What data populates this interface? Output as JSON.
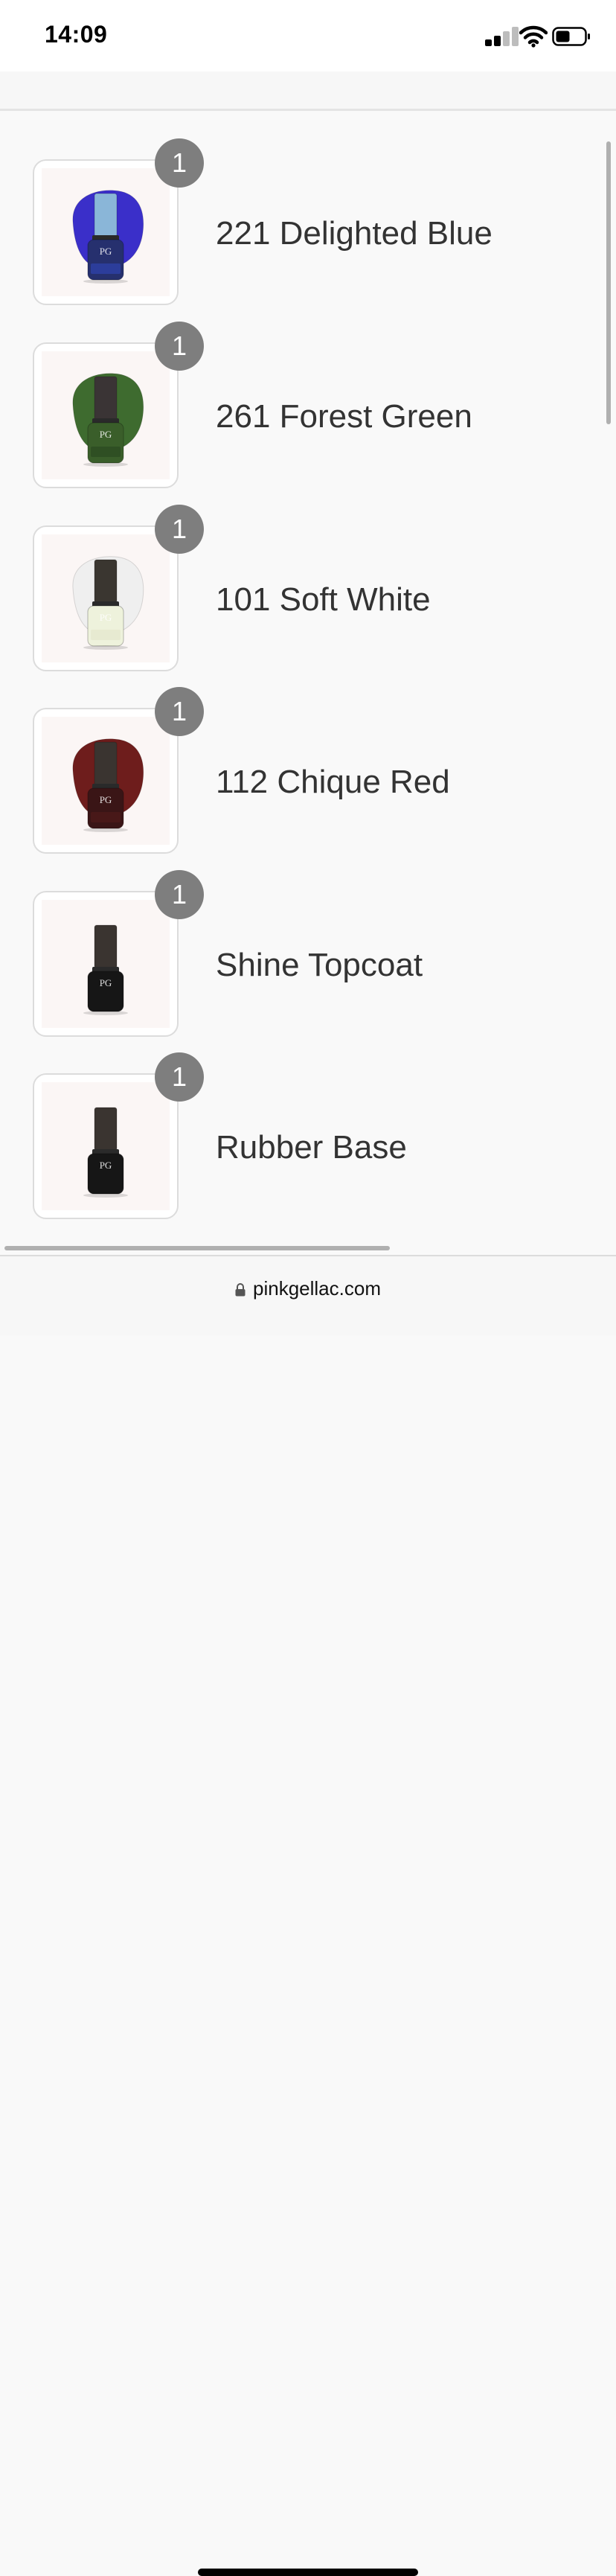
{
  "status_bar": {
    "time": "14:09"
  },
  "cart": {
    "items": [
      {
        "name": "221 Delighted Blue",
        "quantity": "1",
        "swatch": "#3a2fc9",
        "bottle": "#26306e",
        "cap": "#8ab6d8",
        "label": "#2d3fa0",
        "image": "delighted-blue-polish-image"
      },
      {
        "name": "261 Forest Green",
        "quantity": "1",
        "swatch": "#3e6b2f",
        "bottle": "#3a5e2a",
        "cap": "#3a3435",
        "label": "#2f4e22",
        "image": "forest-green-polish-image"
      },
      {
        "name": "101 Soft White",
        "quantity": "1",
        "swatch": "#efefef",
        "bottle": "#eef2dc",
        "cap": "#3a3630",
        "label": "#e5e9cf",
        "image": "soft-white-polish-image"
      },
      {
        "name": "112 Chique Red",
        "quantity": "1",
        "swatch": "#6e1d1c",
        "bottle": "#3a1516",
        "cap": "#3a3430",
        "label": "#4a1818",
        "image": "chique-red-polish-image"
      },
      {
        "name": "Shine Topcoat",
        "quantity": "1",
        "swatch": "",
        "bottle": "#161616",
        "cap": "#3a3430",
        "label": "#161616",
        "image": "shine-topcoat-bottle-image"
      },
      {
        "name": "Rubber Base",
        "quantity": "1",
        "swatch": "",
        "bottle": "#161616",
        "cap": "#3a3430",
        "label": "#161616",
        "image": "rubber-base-bottle-image"
      }
    ]
  },
  "browser": {
    "url": "pinkgellac.com"
  },
  "colors": {
    "badge": "#7e7e7e",
    "text": "#333333",
    "background": "#f9f9f9"
  }
}
